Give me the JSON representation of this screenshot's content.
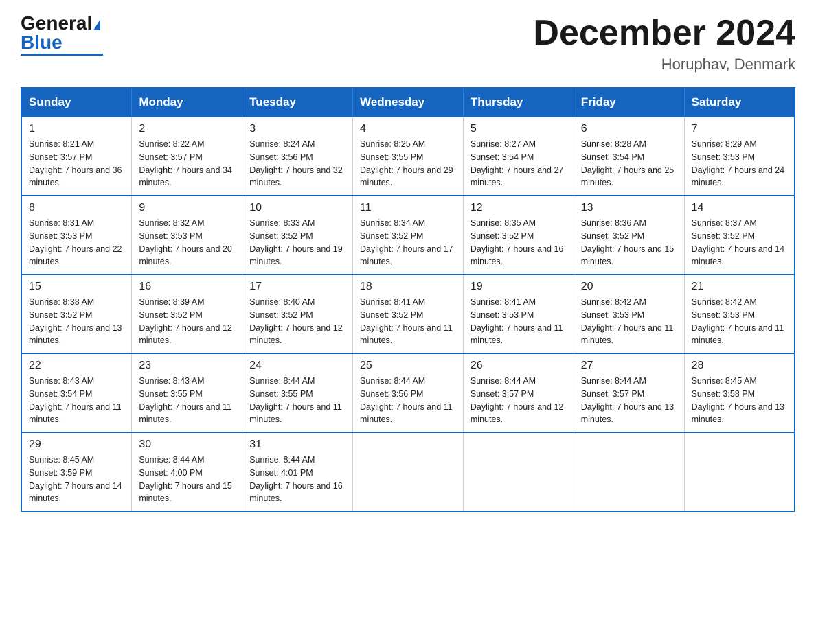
{
  "header": {
    "logo_general": "General",
    "logo_blue": "Blue",
    "month_title": "December 2024",
    "location": "Horuphav, Denmark"
  },
  "days_of_week": [
    "Sunday",
    "Monday",
    "Tuesday",
    "Wednesday",
    "Thursday",
    "Friday",
    "Saturday"
  ],
  "weeks": [
    [
      {
        "day": "1",
        "sunrise": "8:21 AM",
        "sunset": "3:57 PM",
        "daylight": "7 hours and 36 minutes."
      },
      {
        "day": "2",
        "sunrise": "8:22 AM",
        "sunset": "3:57 PM",
        "daylight": "7 hours and 34 minutes."
      },
      {
        "day": "3",
        "sunrise": "8:24 AM",
        "sunset": "3:56 PM",
        "daylight": "7 hours and 32 minutes."
      },
      {
        "day": "4",
        "sunrise": "8:25 AM",
        "sunset": "3:55 PM",
        "daylight": "7 hours and 29 minutes."
      },
      {
        "day": "5",
        "sunrise": "8:27 AM",
        "sunset": "3:54 PM",
        "daylight": "7 hours and 27 minutes."
      },
      {
        "day": "6",
        "sunrise": "8:28 AM",
        "sunset": "3:54 PM",
        "daylight": "7 hours and 25 minutes."
      },
      {
        "day": "7",
        "sunrise": "8:29 AM",
        "sunset": "3:53 PM",
        "daylight": "7 hours and 24 minutes."
      }
    ],
    [
      {
        "day": "8",
        "sunrise": "8:31 AM",
        "sunset": "3:53 PM",
        "daylight": "7 hours and 22 minutes."
      },
      {
        "day": "9",
        "sunrise": "8:32 AM",
        "sunset": "3:53 PM",
        "daylight": "7 hours and 20 minutes."
      },
      {
        "day": "10",
        "sunrise": "8:33 AM",
        "sunset": "3:52 PM",
        "daylight": "7 hours and 19 minutes."
      },
      {
        "day": "11",
        "sunrise": "8:34 AM",
        "sunset": "3:52 PM",
        "daylight": "7 hours and 17 minutes."
      },
      {
        "day": "12",
        "sunrise": "8:35 AM",
        "sunset": "3:52 PM",
        "daylight": "7 hours and 16 minutes."
      },
      {
        "day": "13",
        "sunrise": "8:36 AM",
        "sunset": "3:52 PM",
        "daylight": "7 hours and 15 minutes."
      },
      {
        "day": "14",
        "sunrise": "8:37 AM",
        "sunset": "3:52 PM",
        "daylight": "7 hours and 14 minutes."
      }
    ],
    [
      {
        "day": "15",
        "sunrise": "8:38 AM",
        "sunset": "3:52 PM",
        "daylight": "7 hours and 13 minutes."
      },
      {
        "day": "16",
        "sunrise": "8:39 AM",
        "sunset": "3:52 PM",
        "daylight": "7 hours and 12 minutes."
      },
      {
        "day": "17",
        "sunrise": "8:40 AM",
        "sunset": "3:52 PM",
        "daylight": "7 hours and 12 minutes."
      },
      {
        "day": "18",
        "sunrise": "8:41 AM",
        "sunset": "3:52 PM",
        "daylight": "7 hours and 11 minutes."
      },
      {
        "day": "19",
        "sunrise": "8:41 AM",
        "sunset": "3:53 PM",
        "daylight": "7 hours and 11 minutes."
      },
      {
        "day": "20",
        "sunrise": "8:42 AM",
        "sunset": "3:53 PM",
        "daylight": "7 hours and 11 minutes."
      },
      {
        "day": "21",
        "sunrise": "8:42 AM",
        "sunset": "3:53 PM",
        "daylight": "7 hours and 11 minutes."
      }
    ],
    [
      {
        "day": "22",
        "sunrise": "8:43 AM",
        "sunset": "3:54 PM",
        "daylight": "7 hours and 11 minutes."
      },
      {
        "day": "23",
        "sunrise": "8:43 AM",
        "sunset": "3:55 PM",
        "daylight": "7 hours and 11 minutes."
      },
      {
        "day": "24",
        "sunrise": "8:44 AM",
        "sunset": "3:55 PM",
        "daylight": "7 hours and 11 minutes."
      },
      {
        "day": "25",
        "sunrise": "8:44 AM",
        "sunset": "3:56 PM",
        "daylight": "7 hours and 11 minutes."
      },
      {
        "day": "26",
        "sunrise": "8:44 AM",
        "sunset": "3:57 PM",
        "daylight": "7 hours and 12 minutes."
      },
      {
        "day": "27",
        "sunrise": "8:44 AM",
        "sunset": "3:57 PM",
        "daylight": "7 hours and 13 minutes."
      },
      {
        "day": "28",
        "sunrise": "8:45 AM",
        "sunset": "3:58 PM",
        "daylight": "7 hours and 13 minutes."
      }
    ],
    [
      {
        "day": "29",
        "sunrise": "8:45 AM",
        "sunset": "3:59 PM",
        "daylight": "7 hours and 14 minutes."
      },
      {
        "day": "30",
        "sunrise": "8:44 AM",
        "sunset": "4:00 PM",
        "daylight": "7 hours and 15 minutes."
      },
      {
        "day": "31",
        "sunrise": "8:44 AM",
        "sunset": "4:01 PM",
        "daylight": "7 hours and 16 minutes."
      },
      null,
      null,
      null,
      null
    ]
  ]
}
